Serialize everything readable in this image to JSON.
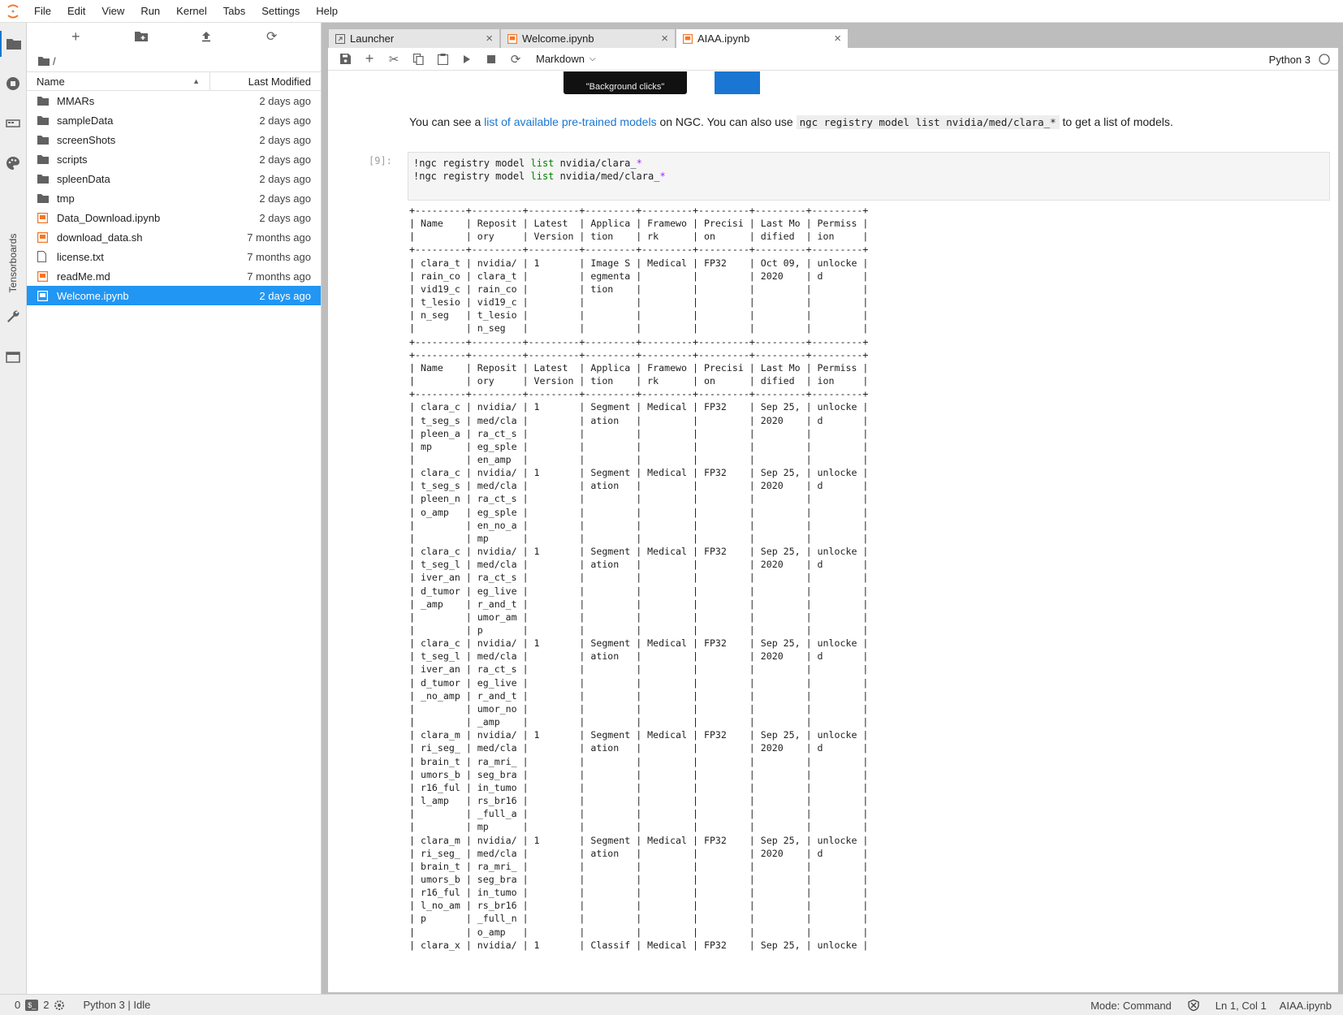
{
  "menubar": {
    "items": [
      "File",
      "Edit",
      "View",
      "Run",
      "Kernel",
      "Tabs",
      "Settings",
      "Help"
    ]
  },
  "sidebar": {
    "tensorboards_label": "Tensorboards"
  },
  "filebrowser": {
    "breadcrumb": "/",
    "header": {
      "name": "Name",
      "modified": "Last Modified"
    },
    "files": [
      {
        "name": "MMARs",
        "modified": "2 days ago",
        "type": "folder"
      },
      {
        "name": "sampleData",
        "modified": "2 days ago",
        "type": "folder"
      },
      {
        "name": "screenShots",
        "modified": "2 days ago",
        "type": "folder"
      },
      {
        "name": "scripts",
        "modified": "2 days ago",
        "type": "folder"
      },
      {
        "name": "spleenData",
        "modified": "2 days ago",
        "type": "folder"
      },
      {
        "name": "tmp",
        "modified": "2 days ago",
        "type": "folder"
      },
      {
        "name": "Data_Download.ipynb",
        "modified": "2 days ago",
        "type": "notebook"
      },
      {
        "name": "download_data.sh",
        "modified": "7 months ago",
        "type": "notebook"
      },
      {
        "name": "license.txt",
        "modified": "7 months ago",
        "type": "text"
      },
      {
        "name": "readMe.md",
        "modified": "7 months ago",
        "type": "notebook"
      },
      {
        "name": "Welcome.ipynb",
        "modified": "2 days ago",
        "type": "notebook",
        "selected": true
      }
    ]
  },
  "tabs": [
    {
      "label": "Launcher",
      "icon": "launcher-icon"
    },
    {
      "label": "Welcome.ipynb",
      "icon": "notebook-icon"
    },
    {
      "label": "AIAA.ipynb",
      "icon": "notebook-icon",
      "current": true
    }
  ],
  "notebook": {
    "cell_type": "Markdown",
    "kernel": "Python 3",
    "image_caption": "\"Background clicks\"",
    "markdown": {
      "pre": "You can see a ",
      "link": "list of available pre-trained models",
      "mid": " on NGC. You can also use ",
      "code": "ngc registry model list nvidia/med/clara_*",
      "post": " to get a list of models."
    },
    "prompt": "[9]:",
    "code_lines": [
      {
        "a": "!ngc registry model ",
        "kw": "list",
        "b": " nvidia/clara_",
        "star": "*"
      },
      {
        "a": "!ngc registry model ",
        "kw": "list",
        "b": " nvidia/med/clara_",
        "star": "*"
      }
    ],
    "output_lines": [
      "+---------+---------+---------+---------+---------+---------+---------+---------+",
      "| Name    | Reposit | Latest  | Applica | Framewo | Precisi | Last Mo | Permiss |",
      "|         | ory     | Version | tion    | rk      | on      | dified  | ion     |",
      "+---------+---------+---------+---------+---------+---------+---------+---------+",
      "| clara_t | nvidia/ | 1       | Image S | Medical | FP32    | Oct 09, | unlocke |",
      "| rain_co | clara_t |         | egmenta |         |         | 2020    | d       |",
      "| vid19_c | rain_co |         | tion    |         |         |         |         |",
      "| t_lesio | vid19_c |         |         |         |         |         |         |",
      "| n_seg   | t_lesio |         |         |         |         |         |         |",
      "|         | n_seg   |         |         |         |         |         |         |",
      "+---------+---------+---------+---------+---------+---------+---------+---------+",
      "+---------+---------+---------+---------+---------+---------+---------+---------+",
      "| Name    | Reposit | Latest  | Applica | Framewo | Precisi | Last Mo | Permiss |",
      "|         | ory     | Version | tion    | rk      | on      | dified  | ion     |",
      "+---------+---------+---------+---------+---------+---------+---------+---------+",
      "| clara_c | nvidia/ | 1       | Segment | Medical | FP32    | Sep 25, | unlocke |",
      "| t_seg_s | med/cla |         | ation   |         |         | 2020    | d       |",
      "| pleen_a | ra_ct_s |         |         |         |         |         |         |",
      "| mp      | eg_sple |         |         |         |         |         |         |",
      "|         | en_amp  |         |         |         |         |         |         |",
      "| clara_c | nvidia/ | 1       | Segment | Medical | FP32    | Sep 25, | unlocke |",
      "| t_seg_s | med/cla |         | ation   |         |         | 2020    | d       |",
      "| pleen_n | ra_ct_s |         |         |         |         |         |         |",
      "| o_amp   | eg_sple |         |         |         |         |         |         |",
      "|         | en_no_a |         |         |         |         |         |         |",
      "|         | mp      |         |         |         |         |         |         |",
      "| clara_c | nvidia/ | 1       | Segment | Medical | FP32    | Sep 25, | unlocke |",
      "| t_seg_l | med/cla |         | ation   |         |         | 2020    | d       |",
      "| iver_an | ra_ct_s |         |         |         |         |         |         |",
      "| d_tumor | eg_live |         |         |         |         |         |         |",
      "| _amp    | r_and_t |         |         |         |         |         |         |",
      "|         | umor_am |         |         |         |         |         |         |",
      "|         | p       |         |         |         |         |         |         |",
      "| clara_c | nvidia/ | 1       | Segment | Medical | FP32    | Sep 25, | unlocke |",
      "| t_seg_l | med/cla |         | ation   |         |         | 2020    | d       |",
      "| iver_an | ra_ct_s |         |         |         |         |         |         |",
      "| d_tumor | eg_live |         |         |         |         |         |         |",
      "| _no_amp | r_and_t |         |         |         |         |         |         |",
      "|         | umor_no |         |         |         |         |         |         |",
      "|         | _amp    |         |         |         |         |         |         |",
      "| clara_m | nvidia/ | 1       | Segment | Medical | FP32    | Sep 25, | unlocke |",
      "| ri_seg_ | med/cla |         | ation   |         |         | 2020    | d       |",
      "| brain_t | ra_mri_ |         |         |         |         |         |         |",
      "| umors_b | seg_bra |         |         |         |         |         |         |",
      "| r16_ful | in_tumo |         |         |         |         |         |         |",
      "| l_amp   | rs_br16 |         |         |         |         |         |         |",
      "|         | _full_a |         |         |         |         |         |         |",
      "|         | mp      |         |         |         |         |         |         |",
      "| clara_m | nvidia/ | 1       | Segment | Medical | FP32    | Sep 25, | unlocke |",
      "| ri_seg_ | med/cla |         | ation   |         |         | 2020    | d       |",
      "| brain_t | ra_mri_ |         |         |         |         |         |         |",
      "| umors_b | seg_bra |         |         |         |         |         |         |",
      "| r16_ful | in_tumo |         |         |         |         |         |         |",
      "| l_no_am | rs_br16 |         |         |         |         |         |         |",
      "| p       | _full_n |         |         |         |         |         |         |",
      "|         | o_amp   |         |         |         |         |         |         |",
      "| clara_x | nvidia/ | 1       | Classif | Medical | FP32    | Sep 25, | unlocke |"
    ]
  },
  "statusbar": {
    "count1": "0",
    "count2": "2",
    "kernel_status": "Python 3 | Idle",
    "mode": "Mode: Command",
    "position": "Ln 1, Col 1",
    "filename": "AIAA.ipynb"
  }
}
